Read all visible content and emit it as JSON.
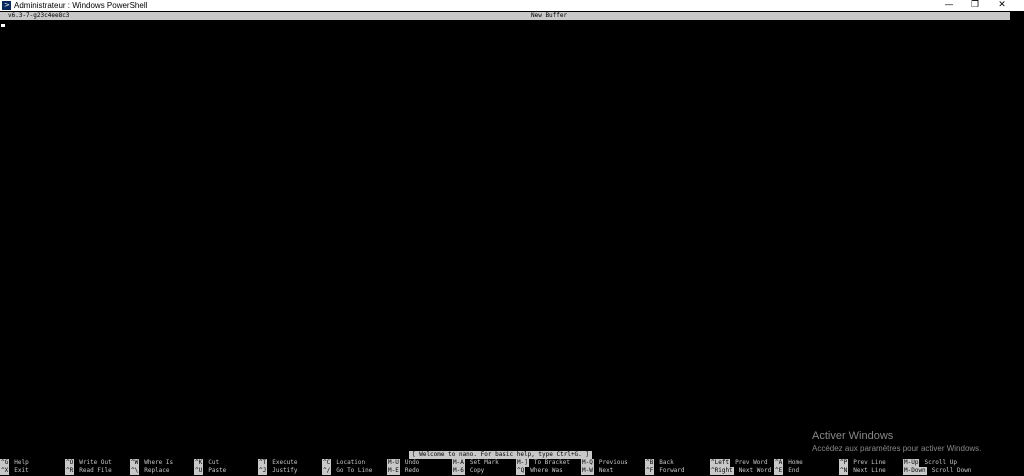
{
  "window": {
    "title": "Administrateur : Windows PowerShell",
    "controls": {
      "minimize": "—",
      "restore": "❐",
      "close": "✕"
    }
  },
  "nano": {
    "version": "v6.3-7-g23c4ee8c3",
    "buffer": "New Buffer",
    "status": "[ Welcome to nano.  For basic help, type Ctrl+G. ]"
  },
  "shortcuts_row1": [
    {
      "key": "^G",
      "label": "Help"
    },
    {
      "key": "^O",
      "label": "Write Out"
    },
    {
      "key": "^W",
      "label": "Where Is"
    },
    {
      "key": "^K",
      "label": "Cut"
    },
    {
      "key": "^T",
      "label": "Execute"
    },
    {
      "key": "^C",
      "label": "Location"
    },
    {
      "key": "M-U",
      "label": "Undo"
    },
    {
      "key": "M-A",
      "label": "Set Mark"
    },
    {
      "key": "M-]",
      "label": "To Bracket"
    },
    {
      "key": "M-Q",
      "label": "Previous"
    },
    {
      "key": "^B",
      "label": "Back"
    },
    {
      "key": "^Left",
      "label": "Prev Word"
    },
    {
      "key": "^A",
      "label": "Home"
    },
    {
      "key": "^P",
      "label": "Prev Line"
    },
    {
      "key": "M-Up",
      "label": "Scroll Up"
    }
  ],
  "shortcuts_row2": [
    {
      "key": "^X",
      "label": "Exit"
    },
    {
      "key": "^R",
      "label": "Read File"
    },
    {
      "key": "^\\",
      "label": "Replace"
    },
    {
      "key": "^U",
      "label": "Paste"
    },
    {
      "key": "^J",
      "label": "Justify"
    },
    {
      "key": "^/",
      "label": "Go To Line"
    },
    {
      "key": "M-E",
      "label": "Redo"
    },
    {
      "key": "M-6",
      "label": "Copy"
    },
    {
      "key": "^Q",
      "label": "Where Was"
    },
    {
      "key": "M-W",
      "label": "Next"
    },
    {
      "key": "^F",
      "label": "Forward"
    },
    {
      "key": "^Right",
      "label": "Next Word"
    },
    {
      "key": "^E",
      "label": "End"
    },
    {
      "key": "^N",
      "label": "Next Line"
    },
    {
      "key": "M-Down",
      "label": "Scroll Down"
    }
  ],
  "watermark": {
    "title": "Activer Windows",
    "subtitle": "Accédez aux paramètres pour activer Windows."
  }
}
